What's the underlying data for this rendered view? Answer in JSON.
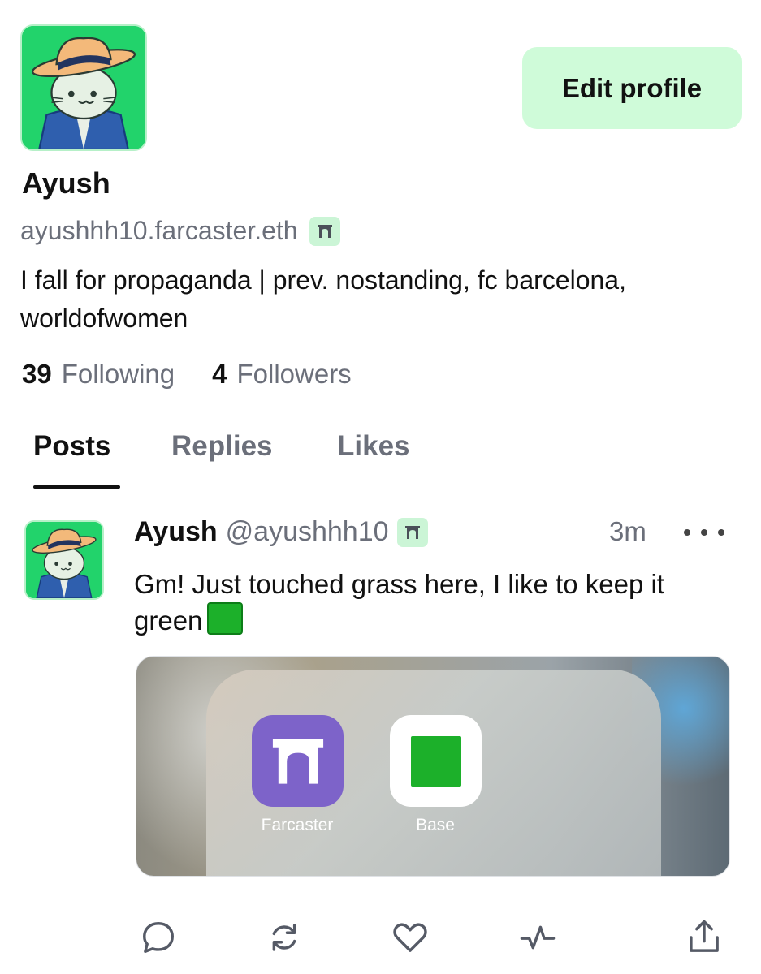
{
  "profile": {
    "display_name": "Ayush",
    "handle": "ayushhh10.farcaster.eth",
    "bio": "I fall for propaganda | prev. nostanding, fc barcelona, worldofwomen",
    "edit_button": "Edit profile",
    "avatar_icon": "cat-cowboy-hat-avatar",
    "badge_icon": "farcaster-arch-icon"
  },
  "stats": {
    "following_count": "39",
    "following_label": "Following",
    "followers_count": "4",
    "followers_label": "Followers"
  },
  "tabs": [
    {
      "label": "Posts",
      "active": true
    },
    {
      "label": "Replies",
      "active": false
    },
    {
      "label": "Likes",
      "active": false
    }
  ],
  "post": {
    "author_name": "Ayush",
    "author_handle": "@ayushhh10",
    "time": "3m",
    "text": "Gm! Just touched grass here, I like to keep it green",
    "emoji": "green-square",
    "media": {
      "apps": [
        {
          "label": "Farcaster",
          "icon": "farcaster-arch-icon",
          "color": "#7d63c9"
        },
        {
          "label": "Base",
          "icon": "base-square-icon",
          "color": "#1cb02a"
        }
      ]
    },
    "actions": [
      "reply-icon",
      "recast-icon",
      "like-icon",
      "activity-icon",
      "share-icon"
    ]
  },
  "colors": {
    "accent_green": "#22d36b",
    "button_bg": "#cffbd9",
    "muted_text": "#6b6f7a",
    "farcaster_purple": "#7d63c9"
  }
}
